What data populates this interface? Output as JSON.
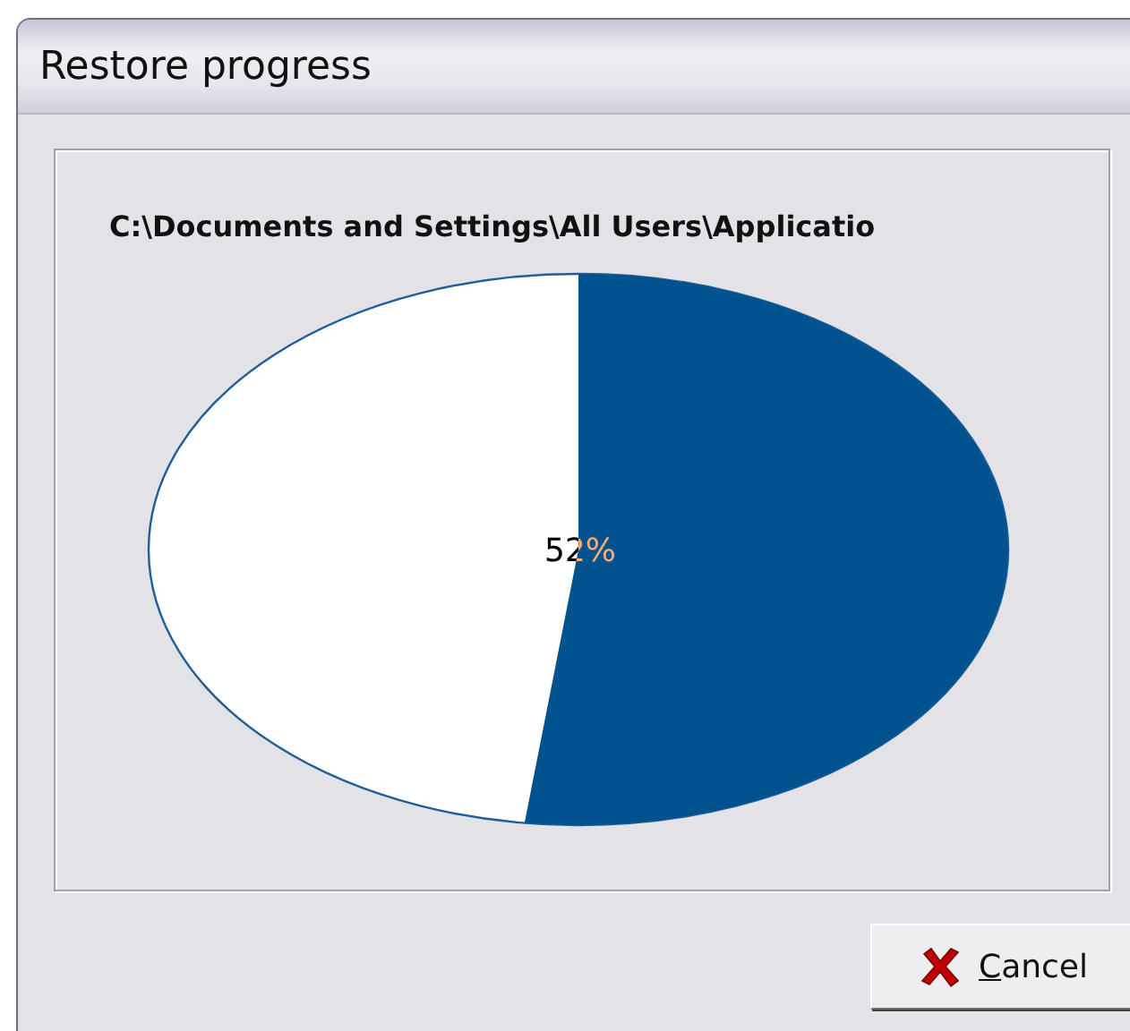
{
  "window": {
    "title": "Restore progress"
  },
  "progress": {
    "path": "C:\\Documents and Settings\\All Users\\Applicatio",
    "level": 0.52,
    "reading": "52%"
  },
  "buttons": [
    {
      "label": "Cancel",
      "kind": "cancel"
    }
  ]
}
